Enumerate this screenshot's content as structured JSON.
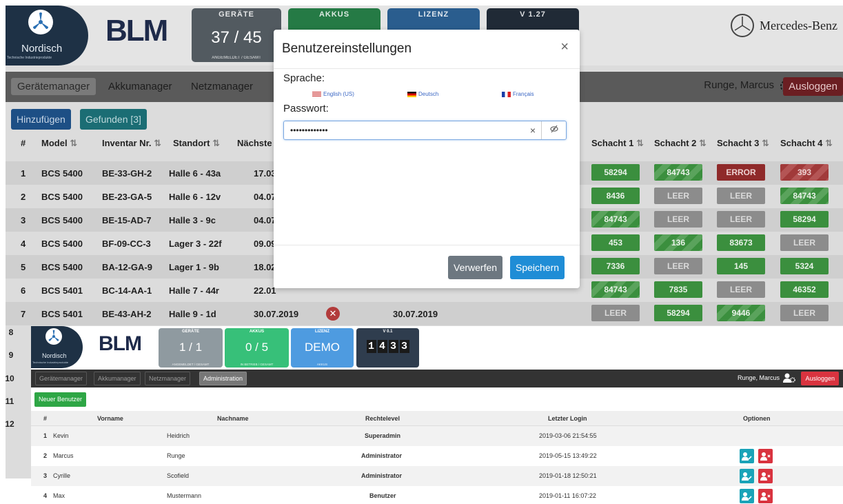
{
  "bg": {
    "logo": {
      "name": "Nordisch",
      "subtitle": "Technische Industrieprodukte",
      "product": "BLM"
    },
    "tiles": {
      "geraete": {
        "head": "GERÄTE",
        "value": "37 / 45",
        "foot": "ANGEMELDET / GESAMT"
      },
      "akkus": {
        "head": "AKKUS"
      },
      "lizenz": {
        "head": "LIZENZ"
      },
      "version": {
        "head": "V 1.27"
      }
    },
    "brand": "Mercedes-Benz",
    "nav": [
      "Gerätemanager",
      "Akkumanager",
      "Netzmanager"
    ],
    "user": "Runge, Marcus",
    "logout": "Ausloggen",
    "btn_add": "Hinzufügen",
    "btn_found": "Gefunden [3]",
    "headers": {
      "num": "#",
      "model": "Model",
      "inv": "Inventar Nr.",
      "loc": "Standort",
      "next": "Nächste",
      "s1": "Schacht 1",
      "s2": "Schacht 2",
      "s3": "Schacht 3",
      "s4": "Schacht 4"
    },
    "rows": [
      {
        "n": "1",
        "model": "BCS 5400",
        "inv": "BE-33-GH-2",
        "loc": "Halle 6 - 43a",
        "date": "17.03",
        "s": [
          "58294",
          "84743",
          "ERROR",
          "393"
        ]
      },
      {
        "n": "2",
        "model": "BCS 5400",
        "inv": "BE-23-GA-5",
        "loc": "Halle 6 - 12v",
        "date": "04.07",
        "s": [
          "8436",
          "LEER",
          "LEER",
          "84743"
        ]
      },
      {
        "n": "3",
        "model": "BCS 5400",
        "inv": "BE-15-AD-7",
        "loc": "Halle 3 - 9c",
        "date": "04.07",
        "s": [
          "84743",
          "LEER",
          "LEER",
          "58294"
        ]
      },
      {
        "n": "4",
        "model": "BCS 5400",
        "inv": "BF-09-CC-3",
        "loc": "Lager 3 - 22f",
        "date": "09.09",
        "s": [
          "453",
          "136",
          "83673",
          "LEER"
        ]
      },
      {
        "n": "5",
        "model": "BCS 5400",
        "inv": "BA-12-GA-9",
        "loc": "Lager 1 - 9b",
        "date": "18.02",
        "s": [
          "7336",
          "LEER",
          "145",
          "5324"
        ]
      },
      {
        "n": "6",
        "model": "BCS 5401",
        "inv": "BC-14-AA-1",
        "loc": "Halle 7 - 44r",
        "date": "22.01",
        "s": [
          "84743",
          "7835",
          "LEER",
          "46352"
        ]
      },
      {
        "n": "7",
        "model": "BCS 5401",
        "inv": "BE-43-AH-2",
        "loc": "Halle 9 - 1d",
        "date": "30.07.2019",
        "date2": "30.07.2019",
        "s": [
          "LEER",
          "58294",
          "9446",
          "LEER"
        ]
      }
    ],
    "more_nums": [
      "8",
      "9",
      "10",
      "11",
      "12"
    ]
  },
  "modal": {
    "title": "Benutzereinstellungen",
    "close": "×",
    "lang_label": "Sprache:",
    "langs": [
      "English (US)",
      "Deutsch",
      "Français"
    ],
    "pw_label": "Passwort:",
    "pw_value": "•••••••••••••",
    "clear": "×",
    "discard": "Verwerfen",
    "save": "Speichern"
  },
  "front": {
    "logo": {
      "name": "Nordisch",
      "subtitle": "Technische Industrieprodukte",
      "product": "BLM"
    },
    "tiles": {
      "geraete": {
        "head": "GERÄTE",
        "value": "1 / 1",
        "foot": "ANGEMELDET / GESAMT"
      },
      "akkus": {
        "head": "AKKUS",
        "value": "0 / 5",
        "foot": "IN BETRIEB / GESAMT"
      },
      "lizenz": {
        "head": "LIZENZ",
        "value": "DEMO",
        "foot": "AKKUS"
      },
      "version": {
        "head": "V 0.1",
        "digits": [
          "1",
          "4",
          "3",
          "3"
        ]
      }
    },
    "nav": [
      "Gerätemanager",
      "Akkumanager",
      "Netzmanager",
      "Administration"
    ],
    "user": "Runge, Marcus",
    "logout": "Ausloggen",
    "new_user": "Neuer Benutzer",
    "headers": {
      "num": "#",
      "first": "Vorname",
      "last": "Nachname",
      "level": "Rechtelevel",
      "login": "Letzter Login",
      "opts": "Optionen"
    },
    "rows": [
      {
        "n": "1",
        "first": "Kevin",
        "last": "Heidrich",
        "level": "Superadmin",
        "login": "2019-03-06 21:54:55"
      },
      {
        "n": "2",
        "first": "Marcus",
        "last": "Runge",
        "level": "Administrator",
        "login": "2019-05-15 13:49:22"
      },
      {
        "n": "3",
        "first": "Cyrille",
        "last": "Scofield",
        "level": "Administrator",
        "login": "2019-01-18 12:50:21"
      },
      {
        "n": "4",
        "first": "Max",
        "last": "Mustermann",
        "level": "Benutzer",
        "login": "2019-01-11 16:07:22"
      }
    ]
  },
  "colors": {
    "green": "#2ea645",
    "blue": "#1f8dd6",
    "red": "#d9333f",
    "teal": "#1aa3b8"
  }
}
